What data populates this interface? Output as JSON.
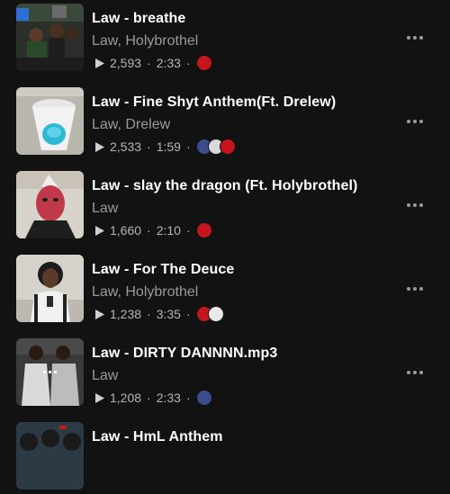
{
  "tracks": [
    {
      "title": "Law - breathe",
      "artists": "Law, Holybrothel",
      "plays": "2,593",
      "duration": "2:33",
      "sep": "·",
      "avatars": [
        "#c4161c"
      ]
    },
    {
      "title": "Law - Fine Shyt Anthem(Ft. Drelew)",
      "artists": "Law, Drelew",
      "plays": "2,533",
      "duration": "1:59",
      "sep": "·",
      "avatars": [
        "#3b4c8c",
        "#d9d9d9",
        "#c4161c"
      ]
    },
    {
      "title": "Law - slay the dragon (Ft. Holybrothel)",
      "artists": "Law",
      "plays": "1,660",
      "duration": "2:10",
      "sep": "·",
      "avatars": [
        "#c4161c"
      ]
    },
    {
      "title": "Law - For The Deuce",
      "artists": "Law, Holybrothel",
      "plays": "1,238",
      "duration": "3:35",
      "sep": "·",
      "avatars": [
        "#c4161c",
        "#e8e8e8"
      ]
    },
    {
      "title": "Law - DIRTY DANNNN.mp3",
      "artists": "Law",
      "plays": "1,208",
      "duration": "2:33",
      "sep": "·",
      "avatars": [
        "#3b4c8c"
      ]
    },
    {
      "title": "Law - HmL Anthem",
      "artists": "",
      "plays": "",
      "duration": "",
      "sep": "",
      "avatars": []
    }
  ],
  "icons": {
    "play": "play-icon",
    "more": "more-options-icon"
  },
  "colors": {
    "background": "#121212",
    "secondary_text": "#9a9a9a",
    "accent": "#c4161c"
  }
}
